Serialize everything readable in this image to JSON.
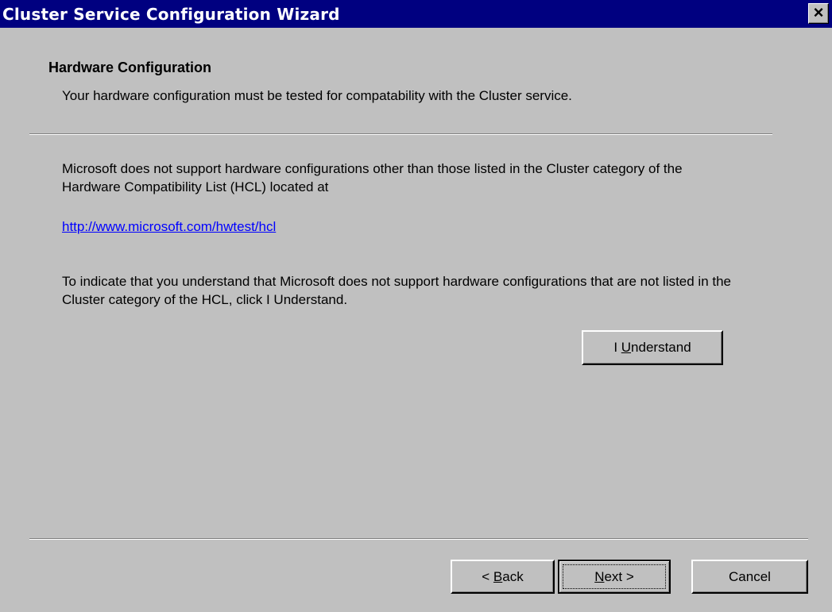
{
  "window": {
    "title": "Cluster Service Configuration Wizard",
    "close_label": "×"
  },
  "header": {
    "heading": "Hardware Configuration",
    "subheading": "Your hardware configuration must be tested for compatability with the Cluster service."
  },
  "body": {
    "paragraph1": "Microsoft does not support hardware configurations other than those listed in the Cluster category of the Hardware Compatibility List (HCL) located at",
    "link": "http://www.microsoft.com/hwtest/hcl",
    "paragraph2": "To indicate that you understand that Microsoft does not support hardware configurations that are not listed in the Cluster category of the HCL, click I Understand."
  },
  "buttons": {
    "understand": {
      "prefix": "I ",
      "mnemonic": "U",
      "suffix": "nderstand"
    },
    "back": {
      "prefix": "< ",
      "mnemonic": "B",
      "suffix": "ack"
    },
    "next": {
      "prefix": "",
      "mnemonic": "N",
      "suffix": "ext >"
    },
    "cancel": "Cancel"
  },
  "colors": {
    "titlebar": "#000080",
    "face": "#c0c0c0",
    "link": "#0000ff"
  }
}
